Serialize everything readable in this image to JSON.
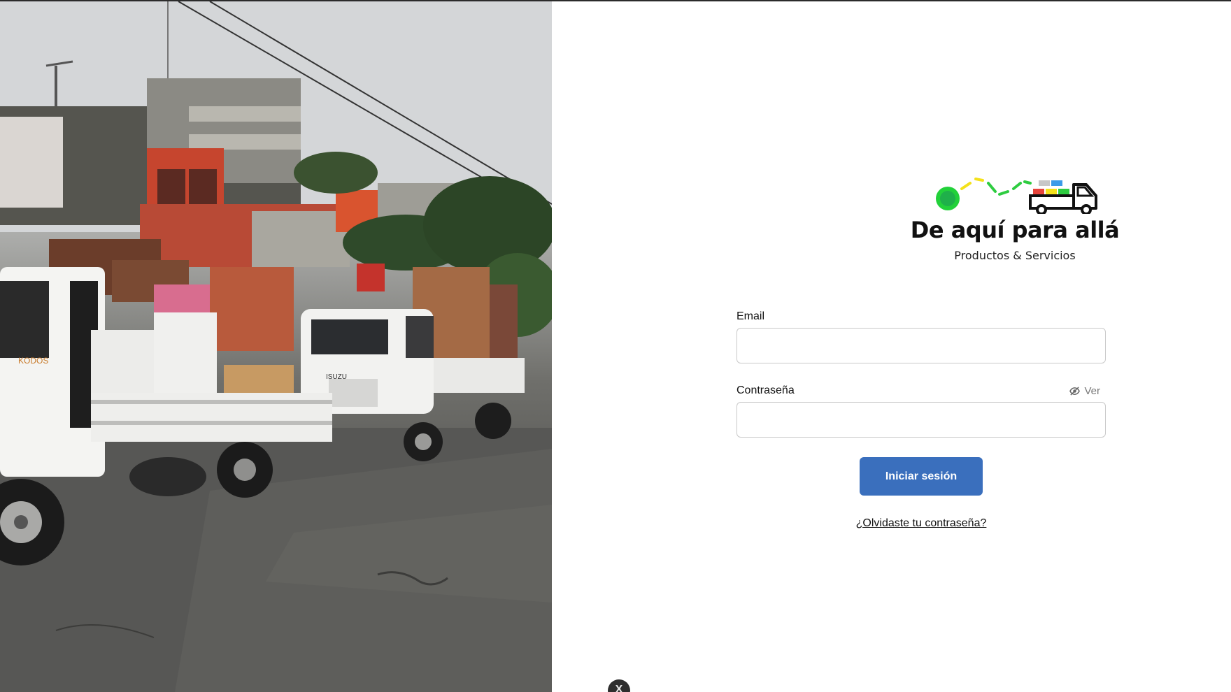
{
  "brand": {
    "title": "De aquí para allá",
    "subtitle": "Productos & Servicios"
  },
  "photo": {
    "description_icon": "photo-trucks-icon"
  },
  "form": {
    "email_label": "Email",
    "email_value": "",
    "password_label": "Contraseña",
    "password_value": "",
    "show_password_label": "Ver",
    "submit_label": "Iniciar sesión",
    "forgot_label": "¿Olvidaste tu contraseña?"
  },
  "floating": {
    "label": "X"
  },
  "colors": {
    "accent": "#3a6fbd",
    "logo_green": "#2ecc40",
    "logo_yellow": "#f4e11a",
    "logo_red": "#e8453c",
    "logo_blue": "#3b9be8"
  }
}
